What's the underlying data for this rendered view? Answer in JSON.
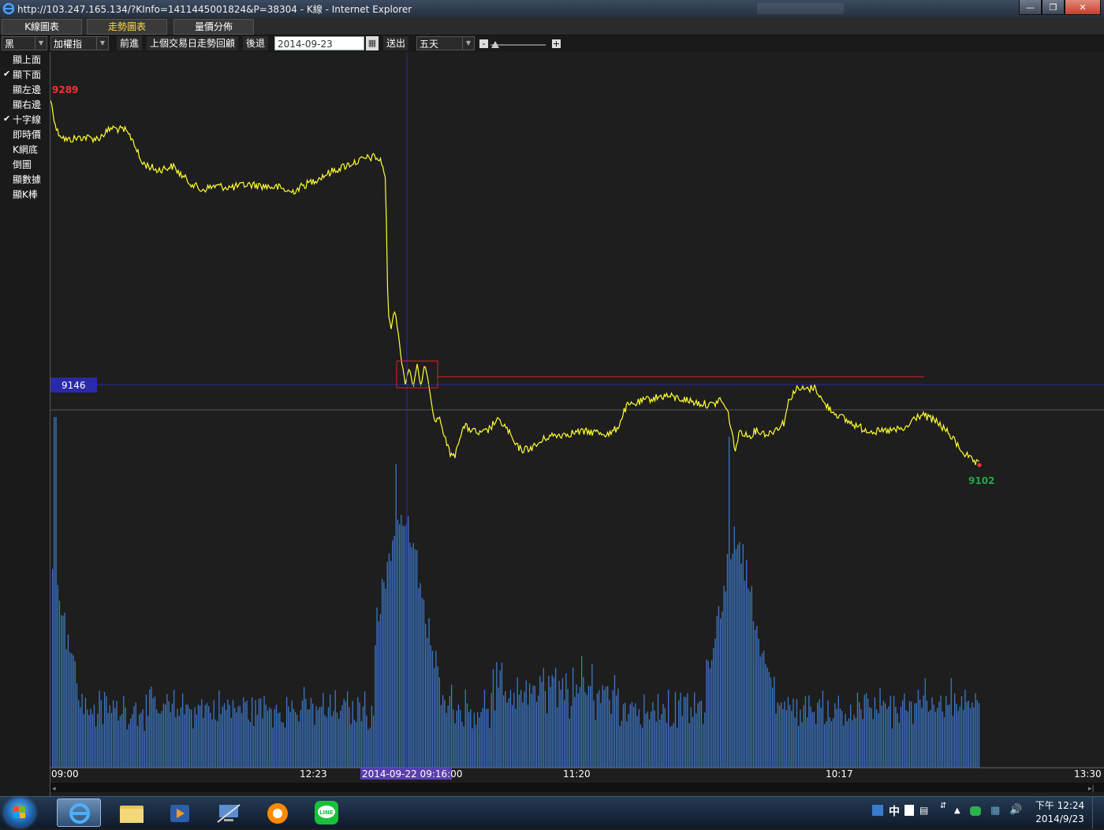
{
  "window": {
    "title": "http://103.247.165.134/?KInfo=1411445001824&P=38304 - K線 - Internet Explorer"
  },
  "tabs": [
    {
      "label": "K線圖表",
      "active": false
    },
    {
      "label": "走勢圖表",
      "active": true
    },
    {
      "label": "量價分佈",
      "active": false
    }
  ],
  "toolbar": {
    "color_select": "黑",
    "index_select": "加權指",
    "forward_label": "前進",
    "prev_day_label": "上個交易日走勢回顧",
    "back_label": "後退",
    "date_value": "2014-09-23",
    "submit_label": "送出",
    "period_select": "五天",
    "minus_label": "-",
    "plus_label": "+"
  },
  "sidebar": {
    "items": [
      {
        "label": "顯上面",
        "checked": false
      },
      {
        "label": "顯下面",
        "checked": true
      },
      {
        "label": "顯左邊",
        "checked": false
      },
      {
        "label": "顯右邊",
        "checked": false
      },
      {
        "label": "十字線",
        "checked": true
      },
      {
        "label": "即時價",
        "checked": false
      },
      {
        "label": "K網底",
        "checked": false
      },
      {
        "label": "倒圖",
        "checked": false
      },
      {
        "label": "顯數據",
        "checked": false
      },
      {
        "label": "顯K棒",
        "checked": false
      }
    ]
  },
  "chart_data": {
    "type": "line",
    "high_label": "9289",
    "low_label": "9102",
    "crosshair_value": "9146",
    "crosshair_time": "2014-09-22 09:16:00",
    "x_ticks": [
      "09:00",
      "12:23",
      "11:20",
      "10:17",
      "13:30"
    ],
    "colors": {
      "price": "#ffff33",
      "volume": "#3c78c8",
      "high": "#ff3030",
      "low": "#22aa44",
      "crosshair": "#2a2aa8"
    }
  },
  "taskbar": {
    "clock_time": "下午 12:24",
    "clock_date": "2014/9/23",
    "ime_label": "中",
    "apps": [
      "ie-icon",
      "explorer-icon",
      "media-player-icon",
      "remote-icon",
      "chrome-like-icon",
      "line-icon"
    ]
  }
}
